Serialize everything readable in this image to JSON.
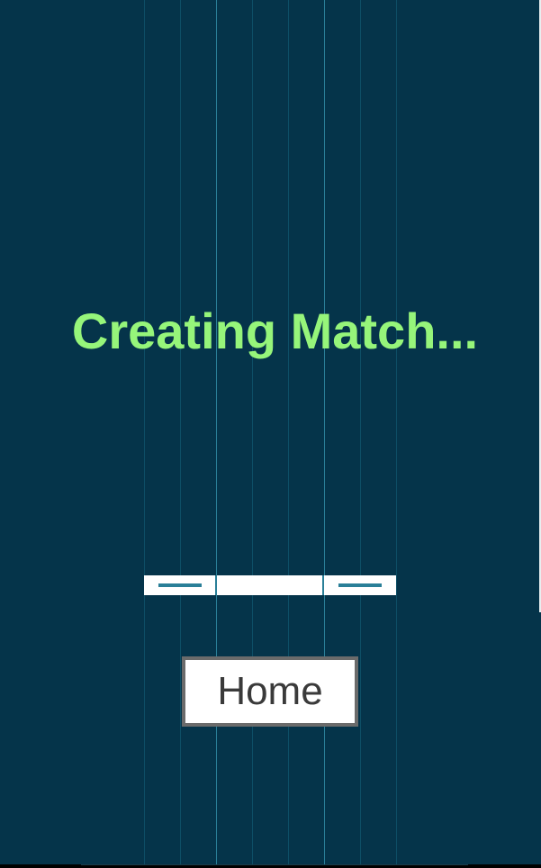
{
  "status": {
    "title": "Creating Match..."
  },
  "actions": {
    "home_label": "Home"
  },
  "theme": {
    "background": "#05344a",
    "title_color": "#96f57a",
    "accent": "#2a7f98",
    "button_border": "#6b6b6b"
  }
}
